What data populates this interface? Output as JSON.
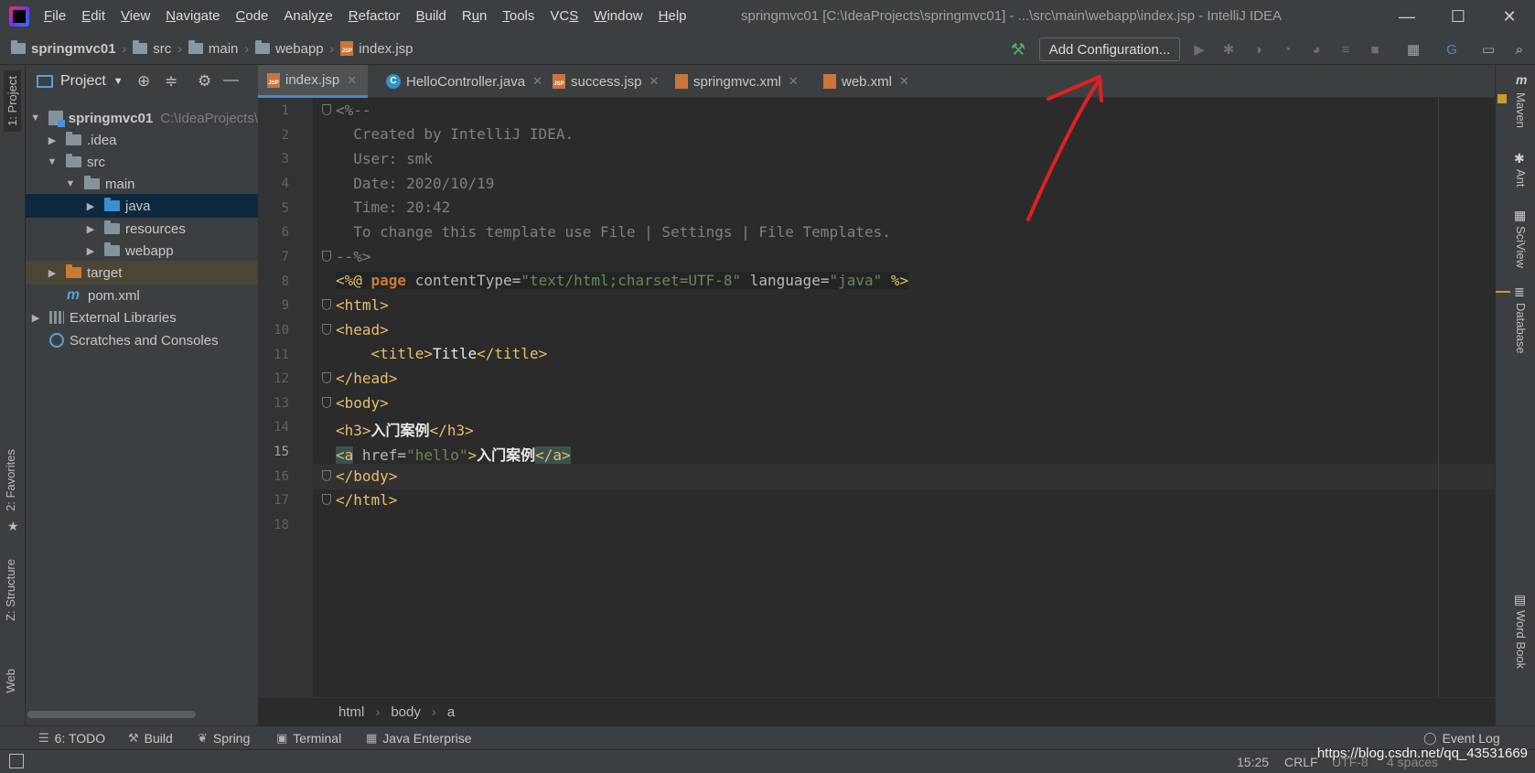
{
  "menu": {
    "items": [
      {
        "pre": "",
        "mn": "F",
        "post": "ile"
      },
      {
        "pre": "",
        "mn": "E",
        "post": "dit"
      },
      {
        "pre": "",
        "mn": "V",
        "post": "iew"
      },
      {
        "pre": "",
        "mn": "N",
        "post": "avigate"
      },
      {
        "pre": "",
        "mn": "C",
        "post": "ode"
      },
      {
        "pre": "Analy",
        "mn": "z",
        "post": "e"
      },
      {
        "pre": "",
        "mn": "R",
        "post": "efactor"
      },
      {
        "pre": "",
        "mn": "B",
        "post": "uild"
      },
      {
        "pre": "R",
        "mn": "u",
        "post": "n"
      },
      {
        "pre": "",
        "mn": "T",
        "post": "ools"
      },
      {
        "pre": "VC",
        "mn": "S",
        "post": ""
      },
      {
        "pre": "",
        "mn": "W",
        "post": "indow"
      },
      {
        "pre": "",
        "mn": "H",
        "post": "elp"
      }
    ]
  },
  "window": {
    "title": "springmvc01 [C:\\IdeaProjects\\springmvc01] - ...\\src\\main\\webapp\\index.jsp - IntelliJ IDEA",
    "minimize": "—",
    "maximize": "☐",
    "close": "✕"
  },
  "navbar": {
    "crumbs": [
      "springmvc01",
      "src",
      "main",
      "webapp",
      "index.jsp"
    ],
    "add_configuration": "Add Configuration..."
  },
  "left_stripe": {
    "project": "1: Project",
    "favorites": "2: Favorites",
    "structure": "Z: Structure",
    "web": "Web"
  },
  "project_panel": {
    "title": "Project",
    "tree": [
      {
        "label": "springmvc01",
        "hint": "C:\\IdeaProjects\\",
        "arrow": "▼"
      },
      {
        "label": ".idea",
        "arrow": "▶"
      },
      {
        "label": "src",
        "arrow": "▼"
      },
      {
        "label": "main",
        "arrow": "▼"
      },
      {
        "label": "java",
        "arrow": "▶"
      },
      {
        "label": "resources",
        "arrow": "▶"
      },
      {
        "label": "webapp",
        "arrow": "▶"
      },
      {
        "label": "target",
        "arrow": "▶"
      },
      {
        "label": "pom.xml",
        "arrow": ""
      },
      {
        "label": "External Libraries",
        "arrow": "▶"
      },
      {
        "label": "Scratches and Consoles",
        "arrow": ""
      }
    ]
  },
  "editor": {
    "tabs": [
      {
        "label": "index.jsp",
        "active": true
      },
      {
        "label": "HelloController.java",
        "active": false
      },
      {
        "label": "success.jsp",
        "active": false
      },
      {
        "label": "springmvc.xml",
        "active": false
      },
      {
        "label": "web.xml",
        "active": false
      }
    ],
    "line_numbers": [
      "1",
      "2",
      "3",
      "4",
      "5",
      "6",
      "7",
      "8",
      "9",
      "10",
      "11",
      "12",
      "13",
      "14",
      "15",
      "16",
      "17",
      "18"
    ],
    "lines": {
      "l1": "<%--",
      "l2": "  Created by IntelliJ IDEA.",
      "l3": "  User: smk",
      "l4": "  Date: 2020/10/19",
      "l5": "  Time: 20:42",
      "l6": "  To change this template use File | Settings | File Templates.",
      "l7": "--%>",
      "l8_open": "<%@ ",
      "l8_page": "page",
      "l8_ct_attr": " contentType=",
      "l8_ct_val": "\"text/html;charset=UTF-8\"",
      "l8_lang_attr": " language=",
      "l8_lang_val": "\"java\"",
      "l8_close": " %>",
      "l9": "<html>",
      "l10": "<head>",
      "l11_open": "    <title>",
      "l11_text": "Title",
      "l11_close": "</title>",
      "l12": "</head>",
      "l13": "<body>",
      "l14_open": "<h3>",
      "l14_text": "入门案例",
      "l14_close": "</h3>",
      "l15_a": "<a",
      "l15_attr": " href=",
      "l15_val": "\"hello\"",
      "l15_gt": ">",
      "l15_text": "入门案例",
      "l15_close": "</a>",
      "l16": "</body>",
      "l17": "</html>"
    },
    "breadcrumb": [
      "html",
      "body",
      "a"
    ]
  },
  "right_stripe": {
    "maven": "Maven",
    "ant": "Ant",
    "sciview": "SciView",
    "database": "Database",
    "wordbook": "Word Book"
  },
  "bottom_tools": {
    "todo": "6: TODO",
    "build": "Build",
    "spring": "Spring",
    "terminal": "Terminal",
    "java_enterprise": "Java Enterprise",
    "event_log": "Event Log"
  },
  "status": {
    "position": "15:25",
    "line_sep": "CRLF",
    "encoding": "UTF-8",
    "indent": "4 spaces"
  },
  "watermark": "https://blog.csdn.net/qq_43531669",
  "colors": {
    "annotation": "#e02020",
    "selection": "#0d293e",
    "accent": "#4a88c7"
  }
}
